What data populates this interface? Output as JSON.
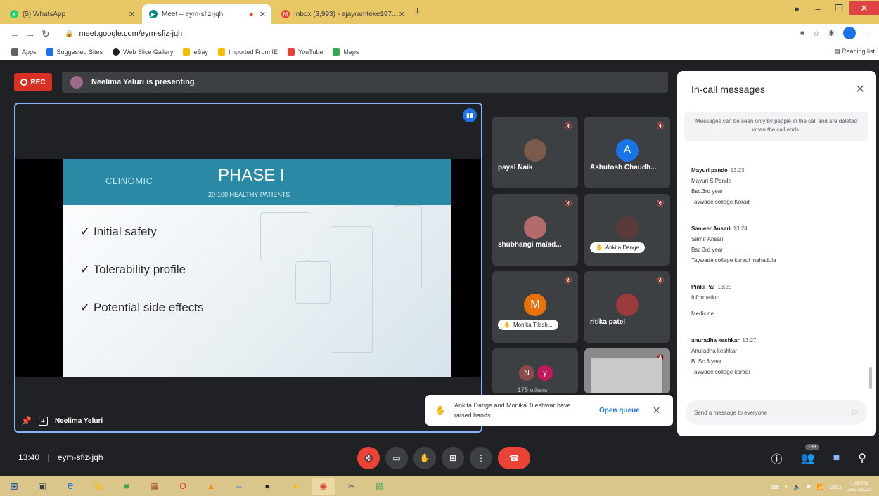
{
  "browser": {
    "tabs": [
      {
        "title": "(5) WhatsApp",
        "icon": "whatsapp-icon",
        "color": "#25d366"
      },
      {
        "title": "Meet – eym-sfiz-jqh",
        "icon": "meet-icon",
        "color": "#00897b",
        "active": true
      },
      {
        "title": "Inbox (3,993) - ajayramteke197…",
        "icon": "gmail-icon",
        "color": "#ea4335"
      }
    ],
    "new_tab": "+",
    "url": "meet.google.com/eym-sfiz-jqh",
    "profile_initial": "A",
    "bookmarks": [
      {
        "label": "Apps",
        "color": "#5f6368"
      },
      {
        "label": "Suggested Sites",
        "color": "#1a73e8"
      },
      {
        "label": "Web Slice Gallery",
        "color": "#202124"
      },
      {
        "label": "eBay",
        "color": "#fbbc04"
      },
      {
        "label": "Imported From IE",
        "color": "#fbbc04"
      },
      {
        "label": "YouTube",
        "color": "#ea4335"
      },
      {
        "label": "Maps",
        "color": "#34a853"
      }
    ],
    "reading_list": "Reading list"
  },
  "meet": {
    "rec_label": "REC",
    "presenting_text": "Neelima Yeluri is presenting",
    "presenter_name": "Neelima Yeluri",
    "slide": {
      "logo": "CLINOMIC",
      "title": "PHASE I",
      "subtitle": "20-100 HEALTHY PATIENTS",
      "bullets": [
        "✓ Initial safety",
        "✓ Tolerability profile",
        "✓ Potential side effects"
      ]
    },
    "tiles": [
      {
        "name": "payal Naik",
        "avatar": "",
        "avatar_color": "#7a5a4a"
      },
      {
        "name": "Ashutosh Chaudh...",
        "avatar": "A",
        "avatar_color": "#1a73e8"
      },
      {
        "name": "shubhangi malad...",
        "avatar": "",
        "avatar_color": "#b36a6a"
      },
      {
        "name": "Ankita Dange",
        "avatar": "",
        "avatar_color": "#5a3a3a"
      },
      {
        "name": "Monika Tilesh...",
        "avatar": "M",
        "avatar_color": "#e8710a"
      },
      {
        "name": "ritika patel",
        "avatar": "",
        "avatar_color": "#9a3a3a"
      },
      {
        "name": "175 others",
        "avatar": "N",
        "avatar2": "y",
        "avatar_color": "#a55"
      },
      {
        "name": "",
        "avatar": "",
        "avatar_color": "#777"
      }
    ],
    "toast": {
      "text": "Ankita Dange and Monika Tileshwar have raised hands",
      "action": "Open queue"
    },
    "meeting_time": "13:40",
    "meeting_code": "eym-sfiz-jqh",
    "people_count": "183"
  },
  "chat": {
    "title": "In-call messages",
    "note": "Messages can be seen only by people in the call and are deleted when the call ends.",
    "messages": [
      {
        "sender": "Mayuri pande",
        "time": "13:23",
        "lines": [
          "Mayuri S.Pande",
          "Bsc.3rd year",
          "Taywade college Koradi"
        ]
      },
      {
        "sender": "Sameer Ansari",
        "time": "13:24",
        "lines": [
          "Samir Ansari",
          "Bsc 3rd year",
          "Taywade college koradi mahadula"
        ]
      },
      {
        "sender": "Pinki Pal",
        "time": "13:25",
        "lines": [
          "Information",
          "",
          "Medicine"
        ]
      },
      {
        "sender": "anuradha keshkar",
        "time": "13:27",
        "lines": [
          "Anuradha keshkar",
          "B. Sc 3 year",
          "Taywade college koradi"
        ]
      }
    ],
    "input_placeholder": "Send a message to everyone"
  },
  "taskbar": {
    "lang": "ENG",
    "time": "1:40 PM",
    "date": "10/27/2021"
  }
}
